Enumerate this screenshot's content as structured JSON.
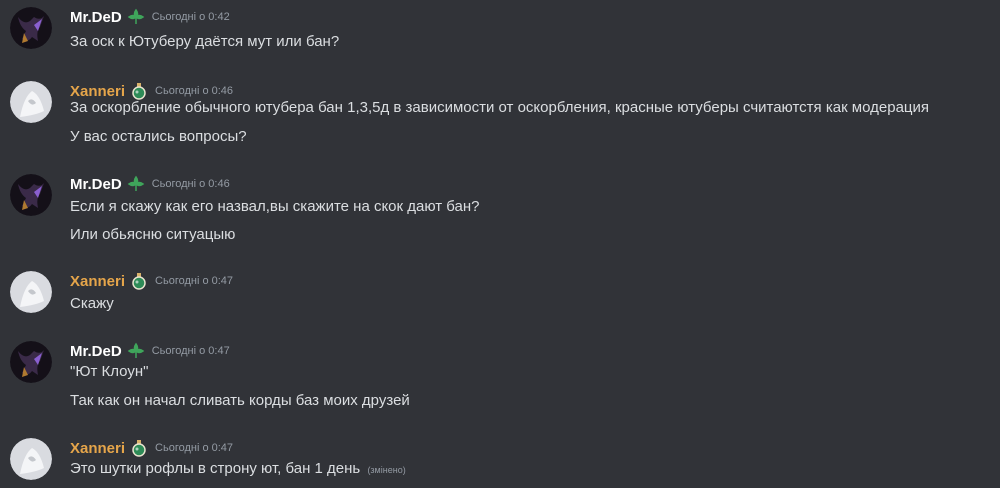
{
  "colors": {
    "background": "#313338",
    "text": "#dbdee1",
    "timestamp": "#949ba4",
    "user_mrded": "#ffffff",
    "user_xanneri": "#e5a54a",
    "badge_green": "#3fa55b"
  },
  "messages": [
    {
      "author": "Mr.DeD",
      "badge": "green-leaf-badge-icon",
      "time": "Сьогодні о 0:42",
      "lines": [
        "За оск к Ютуберу даётся мут или бан?"
      ]
    },
    {
      "author": "Xanneri",
      "badge": "potion-badge-icon",
      "time": "Сьогодні о 0:46",
      "lines": [
        "За оскорбление обычного ютубера бан 1,3,5д в зависимости  от оскорбления, красные ютуберы считаютстя как  модерация",
        "У вас остались вопросы?"
      ]
    },
    {
      "author": "Mr.DeD",
      "badge": "green-leaf-badge-icon",
      "time": "Сьогодні о 0:46",
      "lines": [
        "Если я скажу как его назвал,вы скажите на скок дают бан?",
        "Или обьясню ситуацыю"
      ]
    },
    {
      "author": "Xanneri",
      "badge": "potion-badge-icon",
      "time": "Сьогодні о 0:47",
      "lines": [
        "Скажу"
      ]
    },
    {
      "author": "Mr.DeD",
      "badge": "green-leaf-badge-icon",
      "time": "Сьогодні о 0:47",
      "lines": [
        "\"Ют Клоун\"",
        "Так как он начал сливать корды баз моих друзей"
      ]
    },
    {
      "author": "Xanneri",
      "badge": "potion-badge-icon",
      "time": "Сьогодні о 0:47",
      "lines": [
        "Это шутки рофлы в строну ют, бан 1 день"
      ],
      "edited": "(змінено)"
    }
  ]
}
